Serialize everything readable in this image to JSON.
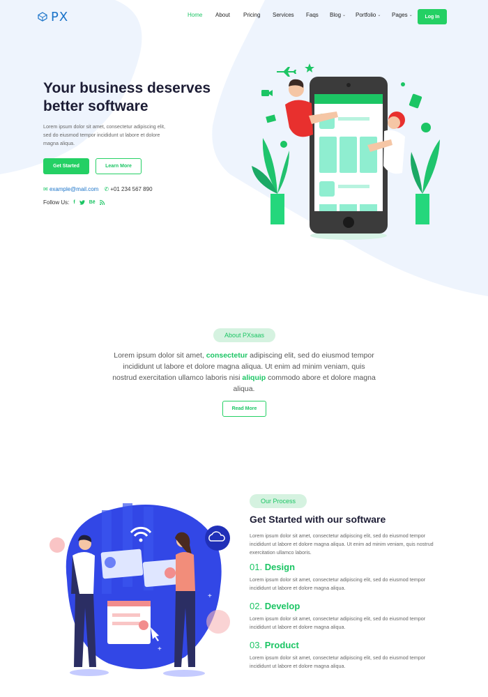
{
  "brand": {
    "name": "PX"
  },
  "nav": {
    "items": [
      {
        "label": "Home",
        "active": true,
        "has_dropdown": false
      },
      {
        "label": "About",
        "active": false,
        "has_dropdown": false
      },
      {
        "label": "Pricing",
        "active": false,
        "has_dropdown": false
      },
      {
        "label": "Services",
        "active": false,
        "has_dropdown": false
      },
      {
        "label": "Faqs",
        "active": false,
        "has_dropdown": false
      },
      {
        "label": "Blog",
        "active": false,
        "has_dropdown": true
      },
      {
        "label": "Portfolio",
        "active": false,
        "has_dropdown": true
      },
      {
        "label": "Pages",
        "active": false,
        "has_dropdown": true
      }
    ],
    "login_label": "Log In"
  },
  "hero": {
    "title": "Your business deserves better software",
    "text": "Lorem ipsum dolor sit amet, consectetur adipiscing elit, sed do eiusmod tempor incididunt ut labore et dolore magna aliqua.",
    "primary_button": "Get Started",
    "secondary_button": "Learn More",
    "email": "example@mail.com",
    "phone": "+01 234 567 890",
    "follow_label": "Follow Us:",
    "social_icons": [
      "facebook-icon",
      "twitter-icon",
      "behance-icon",
      "rss-icon"
    ]
  },
  "about": {
    "badge": "About PXsaas",
    "text_parts": {
      "a": "Lorem ipsum dolor sit amet, ",
      "b": "consectetur",
      "c": " adipiscing elit, sed do eiusmod tempor incididunt ut labore et dolore magna aliqua. Ut enim ad minim veniam, quis nostrud exercitation ullamco laboris nisi ",
      "d": "aliquip",
      "e": " commodo abore et dolore magna aliqua."
    },
    "button": "Read More"
  },
  "process": {
    "badge": "Our Process",
    "title": "Get Started with our software",
    "intro": "Lorem ipsum dolor sit amet, consectetur adipiscing elit, sed do eiusmod tempor incididunt ut labore et dolore magna aliqua. Ut enim ad minim veniam, quis nostrud exercitation ullamco laboris.",
    "steps": [
      {
        "num": "01.",
        "name": "Design",
        "text": "Lorem ipsum dolor sit amet, consectetur adipiscing elit, sed do eiusmod tempor incididunt ut labore et dolore magna aliqua."
      },
      {
        "num": "02.",
        "name": "Develop",
        "text": "Lorem ipsum dolor sit amet, consectetur adipiscing elit, sed do eiusmod tempor incididunt ut labore et dolore magna aliqua."
      },
      {
        "num": "03.",
        "name": "Product",
        "text": "Lorem ipsum dolor sit amet, consectetur adipiscing elit, sed do eiusmod tempor incididunt ut labore et dolore magna aliqua."
      }
    ]
  },
  "colors": {
    "accent": "#24d064",
    "brand_blue": "#1a73c9",
    "hero_bg": "#eef4fd",
    "illus_blue": "#3247e6"
  }
}
